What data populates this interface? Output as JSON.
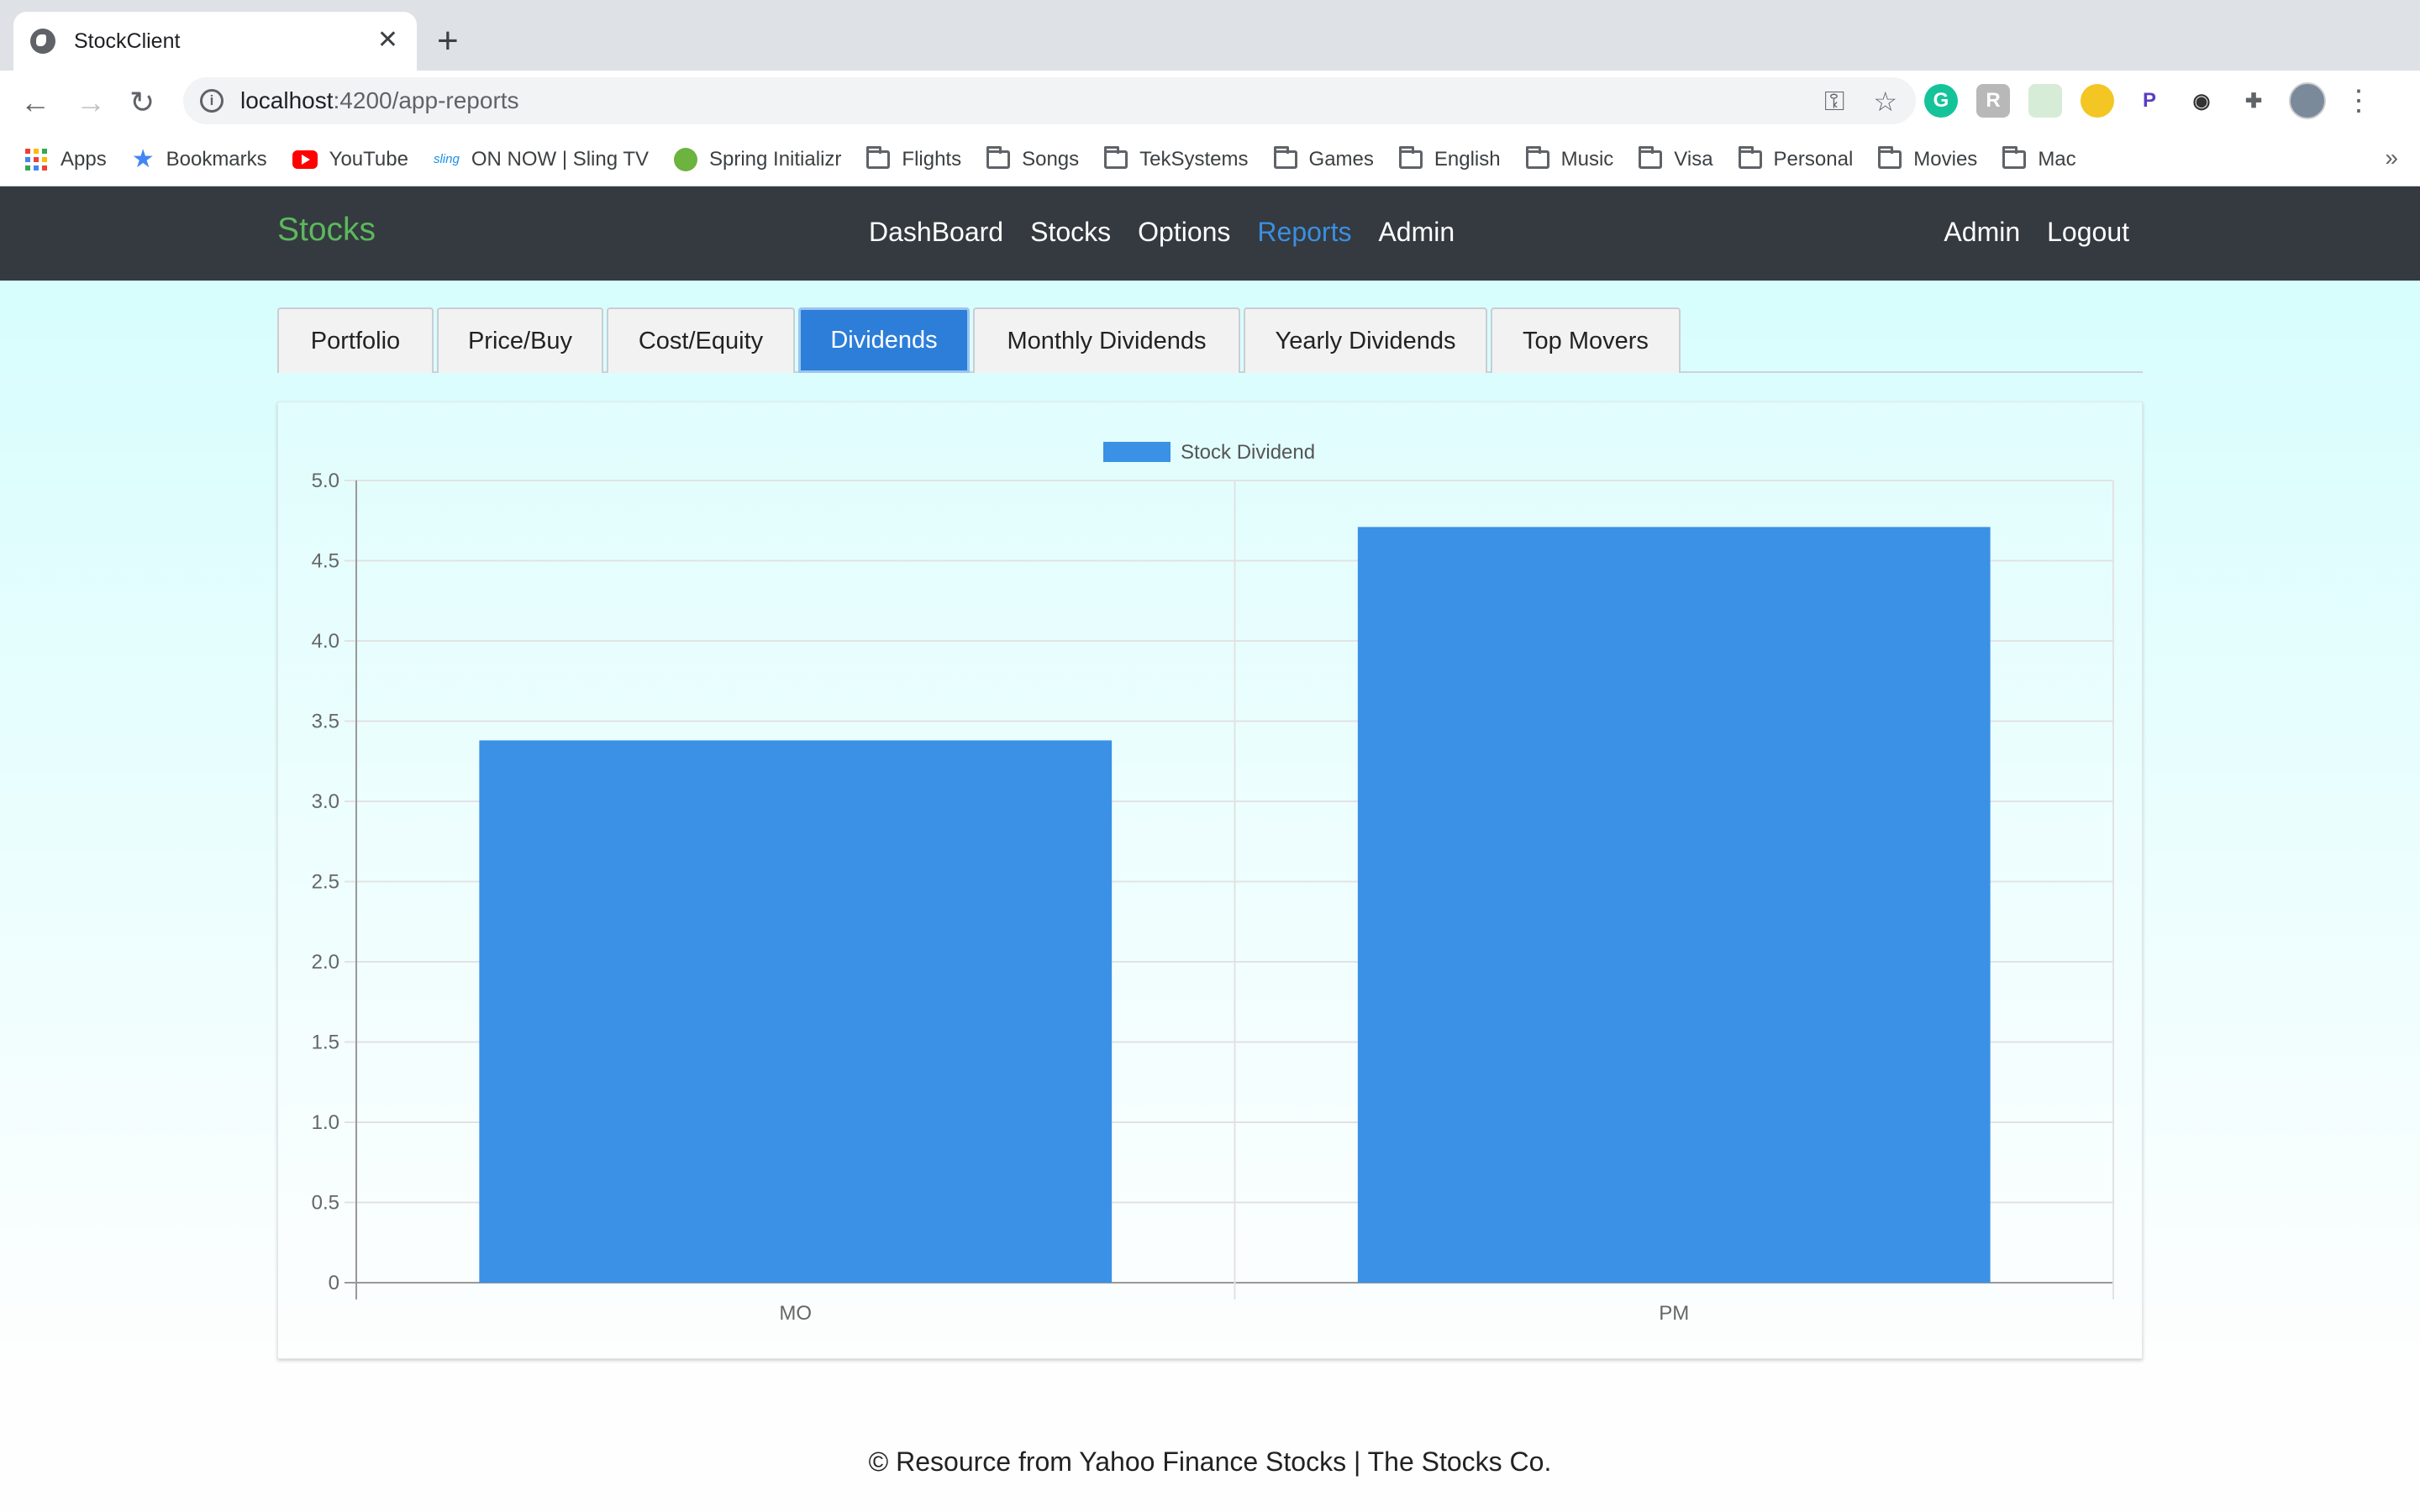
{
  "browser": {
    "tab_title": "StockClient",
    "new_tab": "+",
    "close": "✕",
    "url_host": "localhost",
    "url_path": ":4200/app-reports",
    "bookmarks": [
      {
        "label": "Apps",
        "icon": "apps-grid-icon"
      },
      {
        "label": "Bookmarks",
        "icon": "star-icon"
      },
      {
        "label": "YouTube",
        "icon": "youtube-icon"
      },
      {
        "label": "ON NOW | Sling TV",
        "icon": "sling-icon"
      },
      {
        "label": "Spring Initializr",
        "icon": "spring-icon"
      },
      {
        "label": "Flights",
        "icon": "folder-icon"
      },
      {
        "label": "Songs",
        "icon": "folder-icon"
      },
      {
        "label": "TekSystems",
        "icon": "folder-icon"
      },
      {
        "label": "Games",
        "icon": "folder-icon"
      },
      {
        "label": "English",
        "icon": "folder-icon"
      },
      {
        "label": "Music",
        "icon": "folder-icon"
      },
      {
        "label": "Visa",
        "icon": "folder-icon"
      },
      {
        "label": "Personal",
        "icon": "folder-icon"
      },
      {
        "label": "Movies",
        "icon": "folder-icon"
      },
      {
        "label": "Mac",
        "icon": "folder-icon"
      }
    ],
    "bookmarks_more": "»",
    "sling_text": "sling"
  },
  "navbar": {
    "brand": "Stocks",
    "links": [
      "DashBoard",
      "Stocks",
      "Options",
      "Reports",
      "Admin"
    ],
    "active_link": "Reports",
    "right": [
      "Admin",
      "Logout"
    ]
  },
  "report_tabs": {
    "items": [
      "Portfolio",
      "Price/Buy",
      "Cost/Equity",
      "Dividends",
      "Monthly Dividends",
      "Yearly Dividends",
      "Top Movers"
    ],
    "active": "Dividends"
  },
  "chart_data": {
    "type": "bar",
    "categories": [
      "MO",
      "PM"
    ],
    "series": [
      {
        "name": "Stock Dividend",
        "values": [
          3.38,
          4.71
        ]
      }
    ],
    "ylim": [
      0,
      5
    ],
    "yticks": [
      "0",
      "0.5",
      "1.0",
      "1.5",
      "2.0",
      "2.5",
      "3.0",
      "3.5",
      "4.0",
      "4.5",
      "5.0"
    ],
    "legend": "top",
    "grid": true,
    "bar_color": "#3a91e6"
  },
  "footer": "© Resource from Yahoo Finance Stocks | The Stocks Co."
}
